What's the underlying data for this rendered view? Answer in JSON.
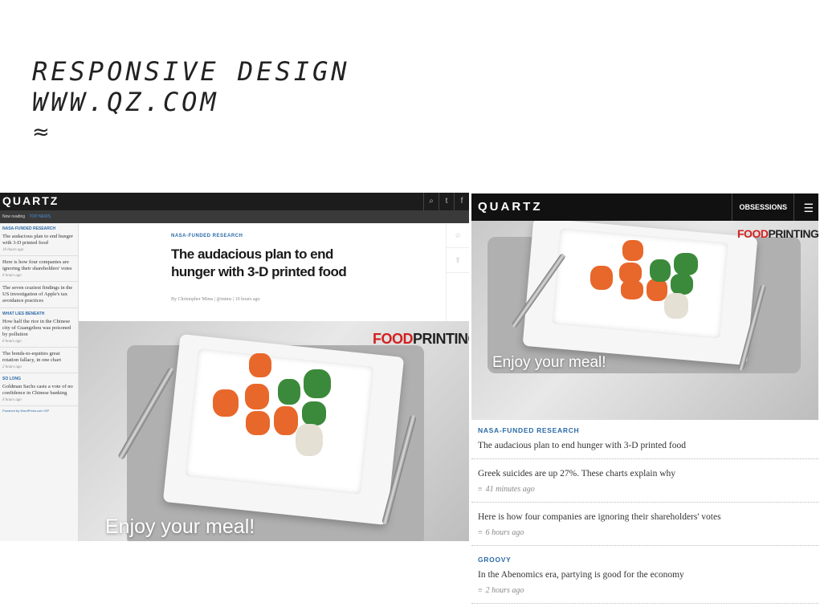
{
  "slide": {
    "title_line1": "RESPONSIVE DESIGN",
    "title_line2": "WWW.QZ.COM",
    "symbol": "≈"
  },
  "desktop": {
    "logo": "QUARTZ",
    "now_reading": "Now reading",
    "top_news": "TOP NEWS",
    "sidebar": [
      {
        "category": "NASA-FUNDED RESEARCH",
        "title": "The audacious plan to end hunger with 3-D printed food",
        "time": "10 hours ago"
      },
      {
        "category": "",
        "title": "Here is how four companies are ignoring their shareholders' votes",
        "time": "6 hours ago"
      },
      {
        "category": "",
        "title": "The seven craziest findings in the US investigation of Apple's tax avoidance practices",
        "time": ""
      },
      {
        "category": "WHAT LIES BENEATH",
        "title": "How half the rice in the Chinese city of Guangzhou was poisoned by pollution",
        "time": "6 hours ago"
      },
      {
        "category": "",
        "title": "The bonds-to-equities great rotation fallacy, in one chart",
        "time": "2 hours ago"
      },
      {
        "category": "SO LONG",
        "title": "Goldman Sachs casts a vote of no confidence in Chinese banking",
        "time": "4 hours ago"
      }
    ],
    "powered_by": "Powered by WordPress.com VIP",
    "article": {
      "category": "NASA-FUNDED RESEARCH",
      "headline": "The audacious plan to end hunger with 3-D printed food",
      "byline": "By Christopher Mims | @mims | 10 hours ago"
    },
    "image_brand_1": "FOOD",
    "image_brand_2": "PRINTING",
    "image_caption": "Enjoy your meal!"
  },
  "mobile": {
    "logo": "QUARTZ",
    "obsessions": "OBSESSIONS",
    "image_brand_1": "FOOD",
    "image_brand_2": "PRINTING",
    "image_caption": "Enjoy your meal!",
    "items": [
      {
        "category": "NASA-FUNDED RESEARCH",
        "title": "The audacious plan to end hunger with 3-D printed food",
        "time": ""
      },
      {
        "category": "",
        "title": "Greek suicides are up 27%. These charts explain why",
        "time": "41 minutes ago"
      },
      {
        "category": "",
        "title": "Here is how four companies are ignoring their shareholders' votes",
        "time": "6 hours ago"
      },
      {
        "category": "GROOVY",
        "title": "In the Abenomics era, partying is good for the economy",
        "time": "2 hours ago"
      }
    ]
  }
}
